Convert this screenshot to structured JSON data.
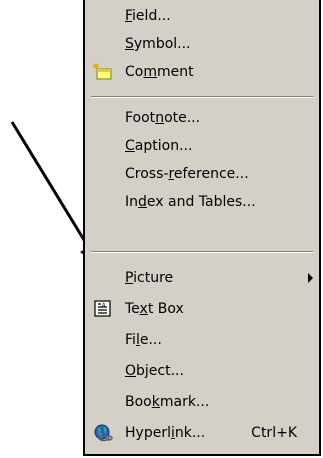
{
  "menu": {
    "items": [
      {
        "pre": "",
        "key": "F",
        "post": "ield...",
        "shortcut": "",
        "icon": ""
      },
      {
        "pre": "",
        "key": "S",
        "post": "ymbol...",
        "shortcut": "",
        "icon": ""
      },
      {
        "pre": "Co",
        "key": "m",
        "post": "ment",
        "shortcut": "",
        "icon": "comment-icon"
      },
      {
        "pre": "Foot",
        "key": "n",
        "post": "ote...",
        "shortcut": "",
        "icon": ""
      },
      {
        "pre": "",
        "key": "C",
        "post": "aption...",
        "shortcut": "",
        "icon": ""
      },
      {
        "pre": "Cross-",
        "key": "r",
        "post": "eference...",
        "shortcut": "",
        "icon": ""
      },
      {
        "pre": "In",
        "key": "d",
        "post": "ex and Tables...",
        "shortcut": "",
        "icon": ""
      },
      {
        "pre": "",
        "key": "P",
        "post": "icture",
        "shortcut": "",
        "icon": ""
      },
      {
        "pre": "Te",
        "key": "x",
        "post": "t Box",
        "shortcut": "",
        "icon": "text-box-icon"
      },
      {
        "pre": "Fi",
        "key": "l",
        "post": "e...",
        "shortcut": "",
        "icon": ""
      },
      {
        "pre": "",
        "key": "O",
        "post": "bject...",
        "shortcut": "",
        "icon": ""
      },
      {
        "pre": "Boo",
        "key": "k",
        "post": "mark...",
        "shortcut": "",
        "icon": ""
      },
      {
        "pre": "Hyperl",
        "key": "i",
        "post": "nk...",
        "shortcut": "Ctrl+K",
        "icon": "hyperlink-icon"
      }
    ]
  },
  "colors": {
    "menu_bg": "#d4d0c8",
    "text": "#000000",
    "separator_dark": "#808080",
    "separator_light": "#ffffff",
    "annotation_arrow": "#000000"
  }
}
